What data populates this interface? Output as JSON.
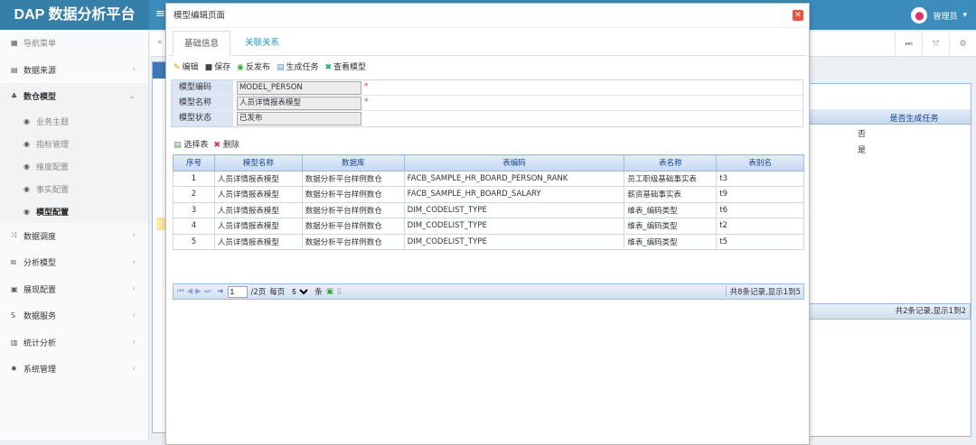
{
  "app": {
    "logo": "DAP 数据分析平台",
    "user": "管理员"
  },
  "sidebar": {
    "header": "导航菜单",
    "items": [
      {
        "label": "数据来源"
      },
      {
        "label": "数仓模型"
      },
      {
        "label": "数据调度"
      },
      {
        "label": "分析模型"
      },
      {
        "label": "展现配置"
      },
      {
        "label": "数据服务"
      },
      {
        "label": "统计分析"
      },
      {
        "label": "系统管理"
      }
    ],
    "sub": [
      "业务主题",
      "指标管理",
      "维度配置",
      "事实配置",
      "模型配置"
    ]
  },
  "background": {
    "col_header": "是否生成任务",
    "rows": [
      "否",
      "是"
    ],
    "pager_summary": "共2条记录,显示1到2"
  },
  "dialog": {
    "title": "模型编辑页面",
    "tabs": [
      "基础信息",
      "关联关系"
    ],
    "toolbar": [
      "编辑",
      "保存",
      "反发布",
      "生成任务",
      "查看模型"
    ],
    "form": [
      {
        "label": "模型编码",
        "value": "MODEL_PERSON",
        "required": true
      },
      {
        "label": "模型名称",
        "value": "人员详情报表模型",
        "required": true
      },
      {
        "label": "模型状态",
        "value": "已发布",
        "required": false
      }
    ],
    "grid_toolbar": [
      "选择表",
      "删除"
    ],
    "columns": [
      "序号",
      "模型名称",
      "数据库",
      "表编码",
      "表名称",
      "表别名"
    ],
    "rows": [
      [
        "1",
        "人员详情报表模型",
        "数据分析平台样例数仓",
        "FACB_SAMPLE_HR_BOARD_PERSON_RANK",
        "员工职级基础事实表",
        "t3"
      ],
      [
        "2",
        "人员详情报表模型",
        "数据分析平台样例数仓",
        "FACB_SAMPLE_HR_BOARD_SALARY",
        "薪资基础事实表",
        "t9"
      ],
      [
        "3",
        "人员详情报表模型",
        "数据分析平台样例数仓",
        "DIM_CODELIST_TYPE",
        "维表_编码类型",
        "t6"
      ],
      [
        "4",
        "人员详情报表模型",
        "数据分析平台样例数仓",
        "DIM_CODELIST_TYPE",
        "维表_编码类型",
        "t2"
      ],
      [
        "5",
        "人员详情报表模型",
        "数据分析平台样例数仓",
        "DIM_CODELIST_TYPE",
        "维表_编码类型",
        "t5"
      ]
    ],
    "pager": {
      "page": "1",
      "total_pages": "/2页",
      "per_page_label": "每页",
      "per_page": "5",
      "unit": "条",
      "summary": "共8条记录,显示1到5"
    }
  }
}
